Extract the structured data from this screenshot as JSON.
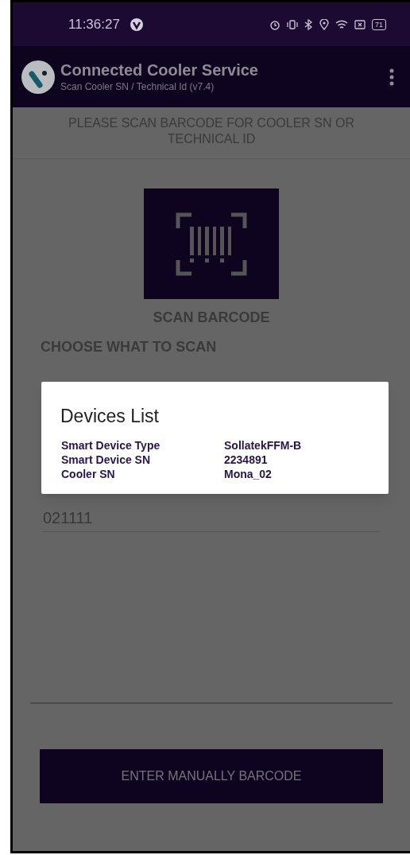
{
  "status_bar": {
    "time": "11:36:27",
    "battery": "71"
  },
  "app_bar": {
    "title": "Connected Cooler Service",
    "subtitle": "Scan Cooler SN / Technical Id (v7.4)"
  },
  "instruction": "PLEASE SCAN BARCODE FOR COOLER SN OR TECHNICAL ID",
  "scan_button": {
    "label": "SCAN BARCODE"
  },
  "choose_label": "CHOOSE WHAT TO SCAN",
  "input": {
    "value": "021111"
  },
  "manual_button": {
    "label": "ENTER MANUALLY BARCODE"
  },
  "dialog": {
    "title": "Devices List",
    "rows": [
      {
        "label": "Smart Device Type",
        "value": "SollatekFFM-B"
      },
      {
        "label": "Smart Device SN",
        "value": "2234891"
      },
      {
        "label": "Cooler SN",
        "value": "Mona_02"
      }
    ]
  }
}
